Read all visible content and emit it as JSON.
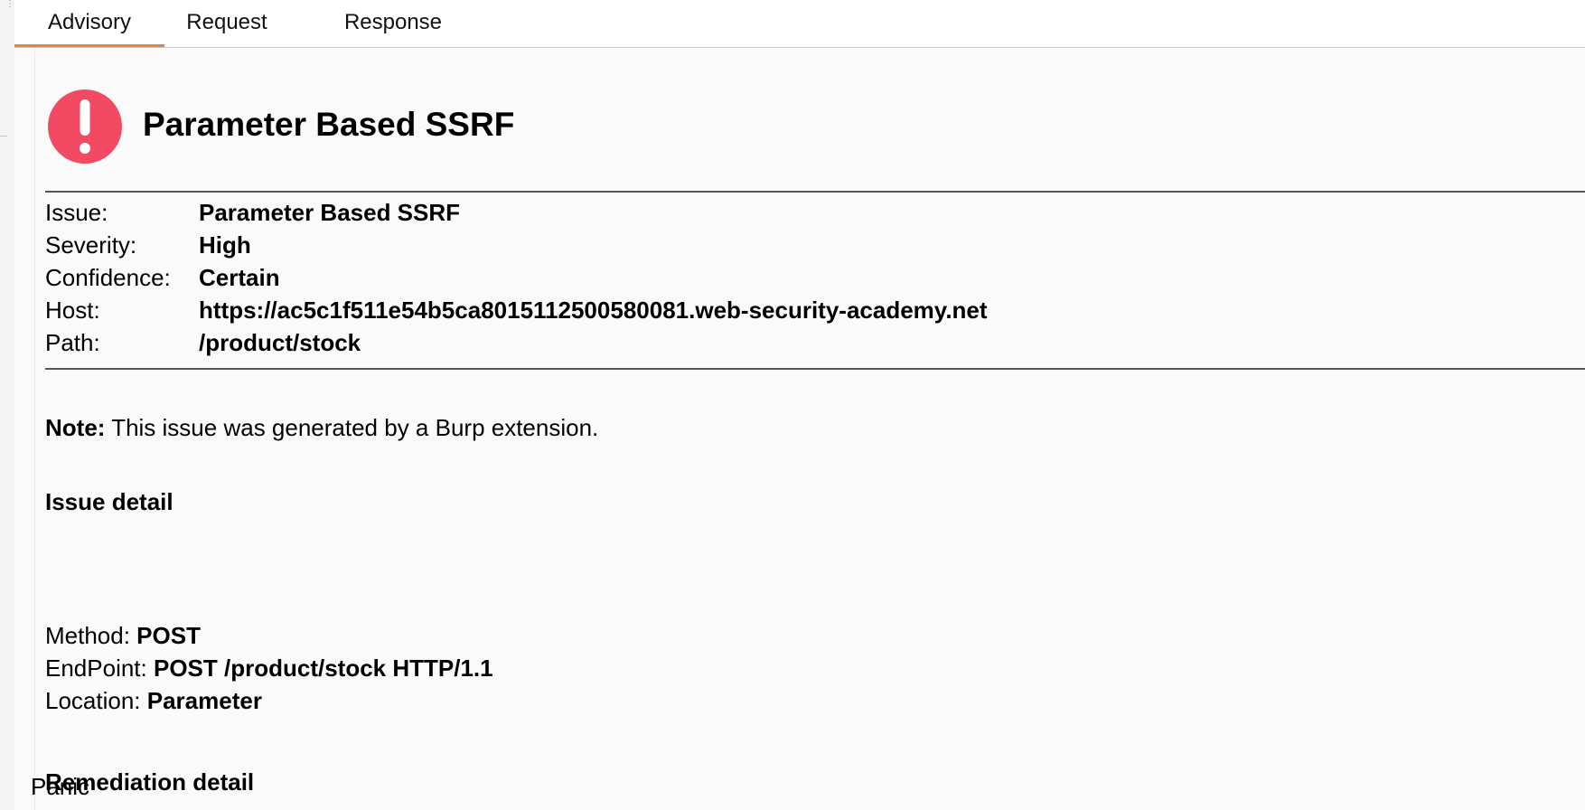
{
  "tabs": [
    {
      "label": "Advisory",
      "active": true
    },
    {
      "label": "Request",
      "active": false
    },
    {
      "label": "Response",
      "active": false
    }
  ],
  "advisory": {
    "title": "Parameter Based SSRF",
    "icon": "alert-exclamation-icon",
    "icon_color": "#f24a63",
    "meta": [
      {
        "key": "Issue:",
        "value": "Parameter Based SSRF"
      },
      {
        "key": "Severity:",
        "value": "High"
      },
      {
        "key": "Confidence:",
        "value": "Certain"
      },
      {
        "key": "Host:",
        "value": "https://ac5c1f511e54b5ca8015112500580081.web-security-academy.net"
      },
      {
        "key": "Path:",
        "value": "/product/stock"
      }
    ],
    "note_label": "Note:",
    "note_text": " This issue was generated by a Burp extension.",
    "issue_detail_heading": "Issue detail",
    "issue_details": [
      {
        "key": "Method: ",
        "value": "POST"
      },
      {
        "key": "EndPoint: ",
        "value": "POST /product/stock HTTP/1.1"
      },
      {
        "key": "Location: ",
        "value": "Parameter"
      }
    ],
    "remediation_heading": "Remediation detail",
    "remediation_text": "Panic"
  },
  "colors": {
    "active_tab_underline": "#e4823f",
    "alert_red": "#f24a63"
  }
}
